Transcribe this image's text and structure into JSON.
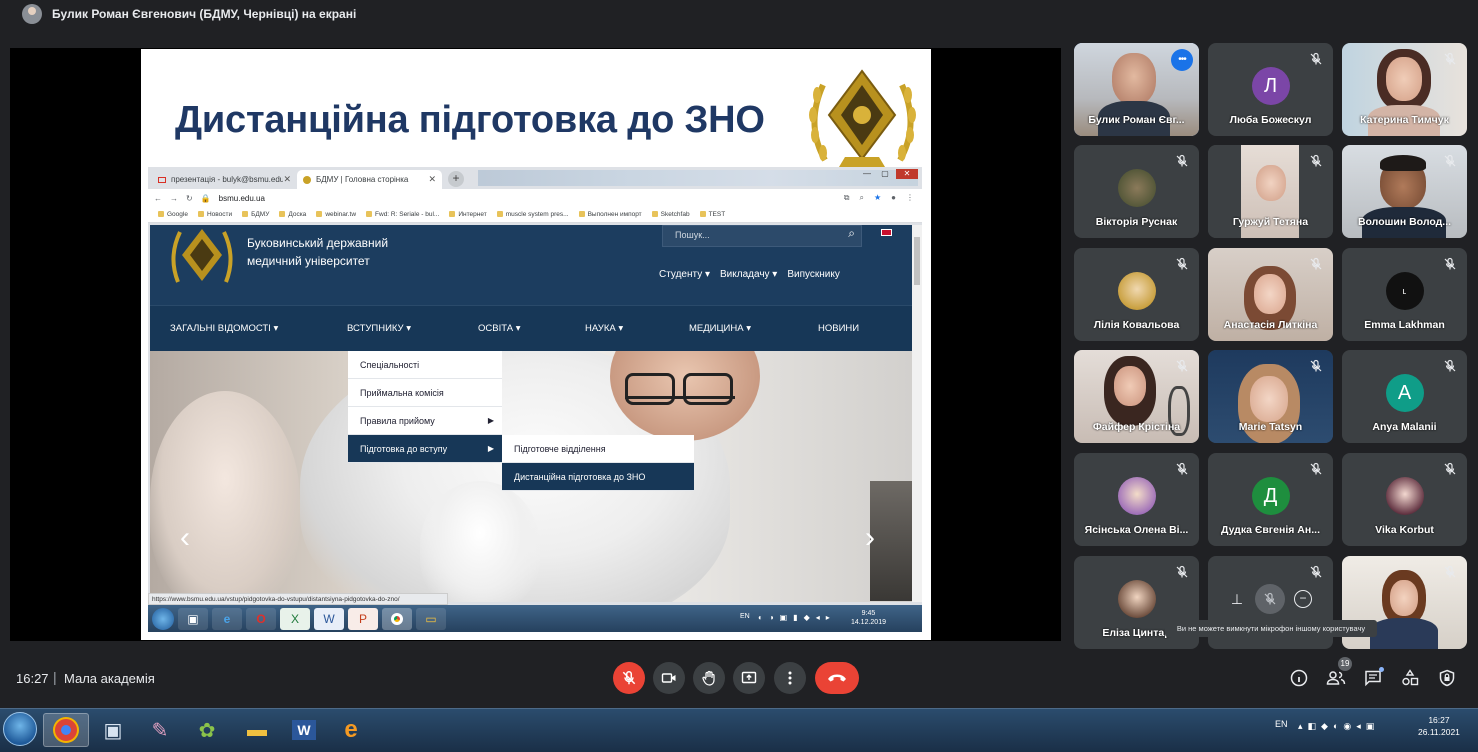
{
  "presentation_banner": {
    "text": "Булик Роман Євгенович (БДМУ, Чернівці) на екрані"
  },
  "slide": {
    "title": "Дистанційна підготовка до ЗНО",
    "browser": {
      "tabs": [
        {
          "label": "презентація - bulyk@bsmu.edu...",
          "icon": "gmail-icon"
        },
        {
          "label": "БДМУ | Головна сторінка",
          "icon": "university-favicon"
        }
      ],
      "url": "bsmu.edu.ua",
      "bookmarks": [
        "Google",
        "Новости",
        "БДМУ",
        "Доска",
        "webinar.tw",
        "Fwd: R: Seriale - bul...",
        "Интернет",
        "muscle system pres...",
        "Выполнен импорт",
        "Sketchfab",
        "TEST"
      ],
      "status_url": "https://www.bsmu.edu.ua/vstup/pidgotovka-do-vstupu/distantsiyna-pidgotovka-do-zno/"
    },
    "site": {
      "name_line1": "Буковинський державний",
      "name_line2": "медичний університет",
      "search_placeholder": "Пошук...",
      "subnav": [
        "Студенту ▾",
        "Викладачу ▾",
        "Випускнику"
      ],
      "mainnav": [
        "ЗАГАЛЬНІ ВІДОМОСТІ ▾",
        "ВСТУПНИКУ ▾",
        "ОСВІТА ▾",
        "НАУКА ▾",
        "МЕДИЦИНА ▾",
        "НОВИНИ"
      ],
      "dropdown": [
        "Спеціальності",
        "Приймальна комісія",
        "Правила прийому",
        "Підготовка до вступу"
      ],
      "subdropdown": [
        "Підготовче відділення",
        "Дистанційна підготовка до ЗНО"
      ]
    },
    "inner_taskbar": {
      "lang": "EN",
      "time": "9:45",
      "date": "14.12.2019"
    }
  },
  "participants": [
    {
      "name": "Булик Роман Євг...",
      "type": "video",
      "speaking": true
    },
    {
      "name": "Люба Божескул",
      "type": "avatar",
      "letter": "Л",
      "color": "#7b46a7"
    },
    {
      "name": "Катерина Тимчук",
      "type": "video"
    },
    {
      "name": "Вікторія Руснак",
      "type": "photo"
    },
    {
      "name": "Гуржуй Тетяна",
      "type": "video"
    },
    {
      "name": "Волошин Волод...",
      "type": "video"
    },
    {
      "name": "Лілія Ковальова",
      "type": "photo"
    },
    {
      "name": "Анастасія Литкіна",
      "type": "video"
    },
    {
      "name": "Emma Lakhman",
      "type": "photo"
    },
    {
      "name": "Файфер Крістіна",
      "type": "video"
    },
    {
      "name": "Marie Tatsyn",
      "type": "video"
    },
    {
      "name": "Anya Malanii",
      "type": "avatar",
      "letter": "A",
      "color": "#0f9d88"
    },
    {
      "name": "Ясінська Олена Ві...",
      "type": "photo"
    },
    {
      "name": "Дудка Євгенія Ан...",
      "type": "avatar",
      "letter": "Д",
      "color": "#1e8e3e"
    },
    {
      "name": "Vika Korbut",
      "type": "photo"
    },
    {
      "name": "Еліза Цинтар",
      "type": "photo"
    },
    {
      "name": "",
      "type": "controls"
    },
    {
      "name": "",
      "type": "video"
    }
  ],
  "tooltip": "Ви не можете вимкнути мікрофон іншому користувачу",
  "meeting": {
    "time": "16:27",
    "separator": "|",
    "name": "Мала академія",
    "participant_count": "19"
  },
  "os_taskbar": {
    "lang": "EN",
    "time": "16:27",
    "date": "26.11.2021"
  },
  "colors": {
    "accent_red": "#ea4335",
    "control_gray": "#3c4043",
    "background": "#202124",
    "slide_title": "#1f3864",
    "site_navy": "#173757"
  }
}
